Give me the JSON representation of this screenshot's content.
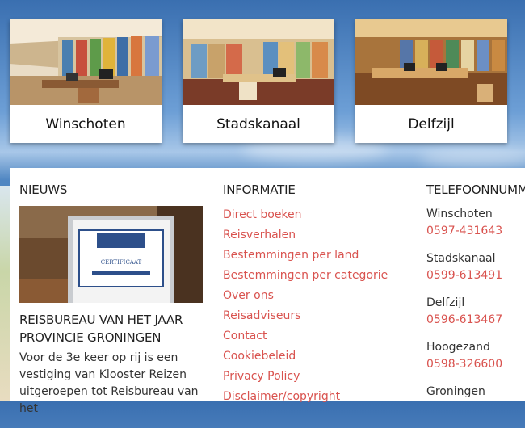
{
  "locations": [
    {
      "name": "Winschoten"
    },
    {
      "name": "Stadskanaal"
    },
    {
      "name": "Delfzijl"
    }
  ],
  "news": {
    "title": "NIEUWS",
    "headline": "REISBUREAU VAN HET JAAR PROVINCIE GRONINGEN",
    "body": "Voor de 3e keer op rij is een vestiging van Klooster Reizen uitgeroepen tot Reisbureau van het",
    "certificate_text": "CERTIFICAAT"
  },
  "info": {
    "title": "INFORMATIE",
    "links": [
      "Direct boeken",
      "Reisverhalen",
      "Bestemmingen per land",
      "Bestemmingen per categorie",
      "Over ons",
      "Reisadviseurs",
      "Contact",
      "Cookiebeleid",
      "Privacy Policy",
      "Disclaimer/copyright"
    ]
  },
  "phones": {
    "title": "TELEFOONNUMM",
    "entries": [
      {
        "city": "Winschoten",
        "number": "0597-431643"
      },
      {
        "city": "Stadskanaal",
        "number": "0599-613491"
      },
      {
        "city": "Delfzijl",
        "number": "0596-613467"
      },
      {
        "city": "Hoogezand",
        "number": "0598-326600"
      },
      {
        "city": "Groningen",
        "number": ""
      }
    ]
  },
  "colors": {
    "link": "#d9534f",
    "text": "#222222"
  }
}
